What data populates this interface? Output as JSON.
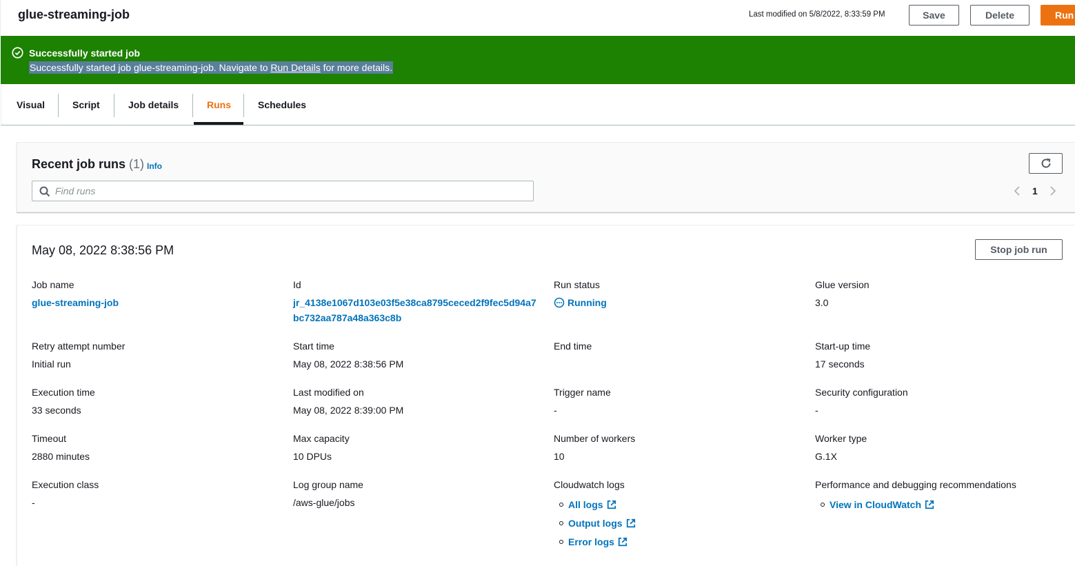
{
  "header": {
    "job_title": "glue-streaming-job",
    "last_modified": "Last modified on 5/8/2022, 8:33:59 PM",
    "save_label": "Save",
    "delete_label": "Delete",
    "run_label": "Run"
  },
  "flash": {
    "title": "Successfully started job",
    "message_prefix": "Successfully started job glue-streaming-job. Navigate to ",
    "link_text": "Run Details",
    "message_suffix": " for more details."
  },
  "tabs": [
    {
      "label": "Visual"
    },
    {
      "label": "Script"
    },
    {
      "label": "Job details"
    },
    {
      "label": "Runs",
      "active": true
    },
    {
      "label": "Schedules"
    }
  ],
  "runs": {
    "title": "Recent job runs",
    "count": "(1)",
    "info_label": "Info",
    "search_placeholder": "Find runs",
    "page_number": "1"
  },
  "detail": {
    "title": "May 08, 2022 8:38:56 PM",
    "stop_label": "Stop job run",
    "job_name_label": "Job name",
    "job_name": "glue-streaming-job",
    "id_label": "Id",
    "id_value": "jr_4138e1067d103e03f5e38ca8795ceced2f9fec5d94a7bc732aa787a48a363c8b",
    "run_status_label": "Run status",
    "run_status": "Running",
    "glue_version_label": "Glue version",
    "glue_version": "3.0",
    "retry_label": "Retry attempt number",
    "retry_value": "Initial run",
    "start_time_label": "Start time",
    "start_time": "May 08, 2022 8:38:56 PM",
    "end_time_label": "End time",
    "startup_time_label": "Start-up time",
    "startup_time": "17 seconds",
    "exec_time_label": "Execution time",
    "exec_time": "33 seconds",
    "last_modified_label": "Last modified on",
    "last_modified": "May 08, 2022 8:39:00 PM",
    "trigger_label": "Trigger name",
    "trigger_value": "-",
    "security_label": "Security configuration",
    "security_value": "-",
    "timeout_label": "Timeout",
    "timeout_value": "2880 minutes",
    "max_capacity_label": "Max capacity",
    "max_capacity": "10 DPUs",
    "workers_label": "Number of workers",
    "workers_value": "10",
    "worker_type_label": "Worker type",
    "worker_type": "G.1X",
    "exec_class_label": "Execution class",
    "exec_class": "-",
    "log_group_label": "Log group name",
    "log_group": "/aws-glue/jobs",
    "cloudwatch_label": "Cloudwatch logs",
    "all_logs": "All logs",
    "output_logs": "Output logs",
    "error_logs": "Error logs",
    "perf_label": "Performance and debugging recommendations",
    "view_cloudwatch": "View in CloudWatch"
  },
  "colors": {
    "accent": "#ec7211",
    "success": "#1d8102",
    "link": "#0073bb"
  }
}
